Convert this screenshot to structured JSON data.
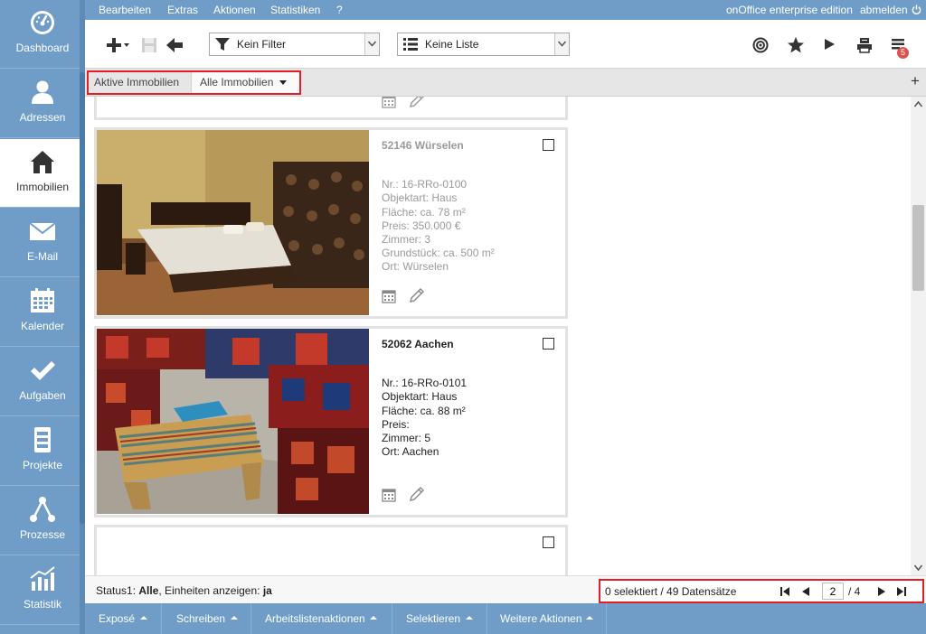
{
  "menubar": {
    "items": [
      "Bearbeiten",
      "Extras",
      "Aktionen",
      "Statistiken",
      "?"
    ],
    "edition": "onOffice enterprise edition",
    "logout": "abmelden"
  },
  "sidebar": {
    "items": [
      {
        "label": "Dashboard",
        "icon": "dashboard-icon"
      },
      {
        "label": "Adressen",
        "icon": "user-icon"
      },
      {
        "label": "Immobilien",
        "icon": "house-icon",
        "active": true
      },
      {
        "label": "E-Mail",
        "icon": "envelope-icon"
      },
      {
        "label": "Kalender",
        "icon": "calendar-icon"
      },
      {
        "label": "Aufgaben",
        "icon": "checkmark-icon"
      },
      {
        "label": "Projekte",
        "icon": "projects-icon"
      },
      {
        "label": "Prozesse",
        "icon": "process-icon"
      },
      {
        "label": "Statistik",
        "icon": "statistics-icon"
      }
    ]
  },
  "toolbar": {
    "filter": {
      "value": "Kein Filter",
      "icon": "filter-icon"
    },
    "list": {
      "value": "Keine Liste",
      "icon": "list-icon"
    },
    "notification_count": "5"
  },
  "tabs": {
    "active_label": "Aktive Immobilien",
    "all_label": "Alle Immobilien",
    "add_symbol": "+"
  },
  "cards": [
    {
      "title": "52146 Würselen",
      "lines": [
        "Nr.: 16-RRo-0100",
        "Objektart: Haus",
        "Fläche: ca. 78 m²",
        "Preis: 350.000 €",
        "Zimmer: 3",
        "Grundstück: ca. 500 m²",
        "Ort: Würselen"
      ],
      "photo": "bedroom-photo",
      "dimmed": true
    },
    {
      "title": "52062 Aachen",
      "lines": [
        "Nr.: 16-RRo-0101",
        "Objektart: Haus",
        "Fläche: ca. 88 m²",
        "Preis:",
        "Zimmer: 5",
        "Ort: Aachen"
      ],
      "photo": "carpet-room-photo",
      "dimmed": false
    }
  ],
  "status": {
    "status1_label": "Status1: ",
    "status1_value": "Alle",
    "units_label": ", Einheiten anzeigen: ",
    "units_value": "ja"
  },
  "pager": {
    "count_text": "0 selektiert / 49 Datensätze",
    "current_page": "2",
    "total_text": "/ 4"
  },
  "actionbar": {
    "items": [
      "Exposé",
      "Schreiben",
      "Arbeitslistenaktionen",
      "Selektieren",
      "Weitere Aktionen"
    ]
  },
  "colors": {
    "brand_blue": "#6f9dc7",
    "highlight_red": "#e31e24",
    "badge_red": "#d9534f"
  }
}
